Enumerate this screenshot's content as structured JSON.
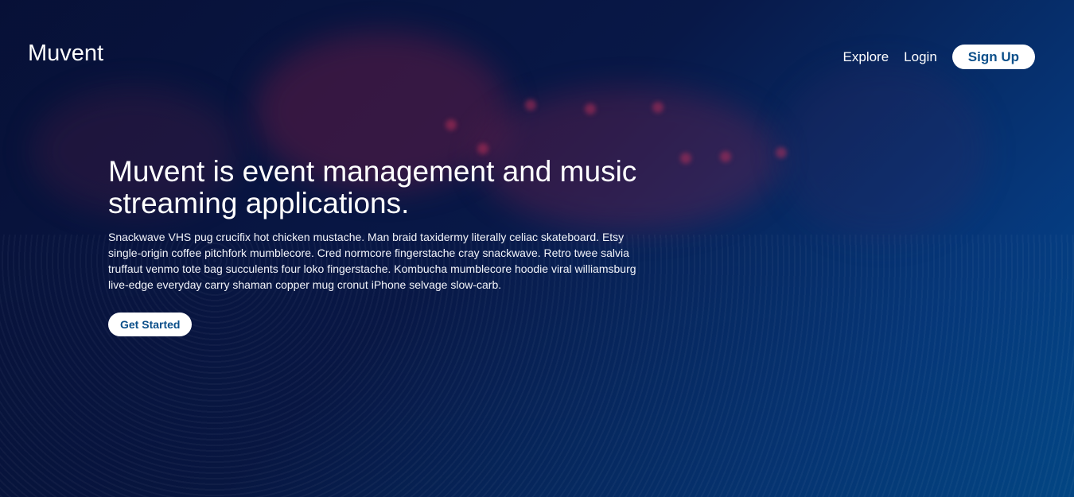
{
  "brand": {
    "name": "Muvent"
  },
  "nav": {
    "explore_label": "Explore",
    "login_label": "Login",
    "signup_label": "Sign Up"
  },
  "hero": {
    "headline": "Muvent is event management and music streaming applications.",
    "description": "Snackwave VHS pug crucifix hot chicken mustache. Man braid taxidermy literally celiac skateboard. Etsy single-origin coffee pitchfork mumblecore. Cred normcore fingerstache cray snackwave. Retro twee salvia truffaut venmo tote bag succulents four loko fingerstache. Kombucha mumblecore hoodie viral williamsburg live-edge everyday carry shaman copper mug cronut iPhone selvage slow-carb.",
    "cta_label": "Get Started"
  },
  "colors": {
    "background_dark": "#0a1640",
    "background_blue": "#02509a",
    "button_text": "#0b4f8a",
    "button_bg": "#ffffff"
  }
}
